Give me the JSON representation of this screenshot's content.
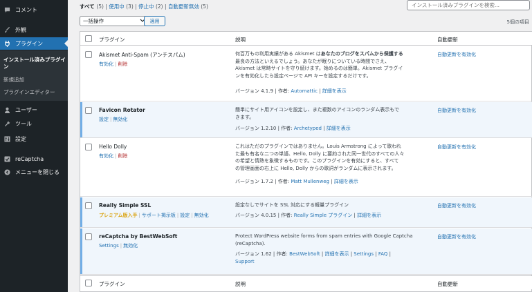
{
  "sidebar": {
    "items": [
      {
        "name": "comments",
        "label": "コメント",
        "icon": "comment-icon"
      },
      {
        "name": "appearance",
        "label": "外観",
        "icon": "brush-icon"
      },
      {
        "name": "plugins",
        "label": "プラグイン",
        "icon": "plugin-icon"
      },
      {
        "name": "users",
        "label": "ユーザー",
        "icon": "user-icon"
      },
      {
        "name": "tools",
        "label": "ツール",
        "icon": "wrench-icon"
      },
      {
        "name": "settings",
        "label": "設定",
        "icon": "settings-icon"
      },
      {
        "name": "recaptcha",
        "label": "reCaptcha",
        "icon": "checkbox-icon"
      },
      {
        "name": "collapse",
        "label": "メニューを閉じる",
        "icon": "collapse-icon"
      }
    ],
    "submenu": {
      "current": "インストール済みプラグイン",
      "add_new": "新規追加",
      "editor": "プラグインエディター"
    }
  },
  "status": {
    "all": "すべて",
    "all_count": "(5)",
    "active": "使用中",
    "active_count": "(3)",
    "inactive": "停止中",
    "inactive_count": "(2)",
    "auto_disabled": "自動更新無効",
    "auto_disabled_count": "(5)"
  },
  "search": {
    "placeholder": "インストール済みプラグインを検索..."
  },
  "bulk": {
    "selected": "一括操作",
    "apply": "適用"
  },
  "items_count": "5個の項目",
  "table": {
    "columns": {
      "plugin": "プラグイン",
      "description": "説明",
      "auto_update": "自動更新"
    },
    "rows": [
      {
        "name": "Akismet Anti-Spam (アンチスパム)",
        "active": false,
        "actions": [
          "有効化",
          "削除"
        ],
        "description_lines": [
          "何百万もの利用実績がある Akismet は",
          "あなたのブログをスパムから保護する",
          "最良の方法といえるでしょう。あなたが眠りについている時間でさえ、",
          "Akismet は常時サイトを守り続けます。始めるのは簡単。Akismet プラグイ",
          "ンを有効化したら設定ページで API キーを設定するだけです。"
        ],
        "version": "バージョン 4.1.9",
        "by": "作者:",
        "author": "Automattic",
        "details": "詳細を表示",
        "auto_update": "自動更新を有効化"
      },
      {
        "name": "Favicon Rotator",
        "active": true,
        "actions": [
          "設定",
          "無効化"
        ],
        "description_lines": [
          "簡単にサイト用アイコンを設定し、また複数のアイコンのランダム表示もで",
          "きます。"
        ],
        "version": "バージョン 1.2.10",
        "by": "作者:",
        "author": "Archetyped",
        "details": "詳細を表示",
        "auto_update": "自動更新を有効化"
      },
      {
        "name": "Hello Dolly",
        "active": false,
        "actions": [
          "有効化",
          "削除"
        ],
        "description_lines": [
          "これはただのプラグインではありません。Louis Armstrong によって歌われ",
          "た最も有名な二つの単語、Hello, Dolly に要約された同一世代のすべての人々",
          "の希望と情熱を象徴するものです。このプラグインを有効にすると、すべて",
          "の管理画面の右上に Hello, Dolly からの歌詞がランダムに表示されます。"
        ],
        "version": "バージョン 1.7.2",
        "by": "作者:",
        "author": "Matt Mullenweg",
        "details": "詳細を表示",
        "auto_update": "自動更新を有効化"
      },
      {
        "name": "Really Simple SSL",
        "active": true,
        "actions": [
          "プレミアム版入手",
          "サポート掲示板",
          "設定",
          "無効化"
        ],
        "description_lines": [
          "設定なしでサイトを SSL 対応にする軽量プラグイン"
        ],
        "version": "バージョン 4.0.15",
        "by": "作者:",
        "author": "Really Simple プラグイン",
        "details": "詳細を表示",
        "auto_update": "自動更新を有効化"
      },
      {
        "name": "reCaptcha by BestWebSoft",
        "active": true,
        "actions": [
          "Settings",
          "無効化"
        ],
        "description_lines": [
          "Protect WordPress website forms from spam entries with Google Captcha",
          "(reCaptcha)."
        ],
        "version": "バージョン 1.62",
        "by": "作者:",
        "author": "BestWebSoft",
        "details": "詳細を表示",
        "extra_links": [
          "Settings",
          "FAQ",
          "Support"
        ],
        "auto_update": "自動更新を有効化"
      }
    ]
  },
  "colors": {
    "sidebar_bg": "#1d2327",
    "accent": "#2271b1",
    "active_row": "#f0f6fc",
    "delete": "#b32d2e",
    "premium": "#dba617"
  }
}
